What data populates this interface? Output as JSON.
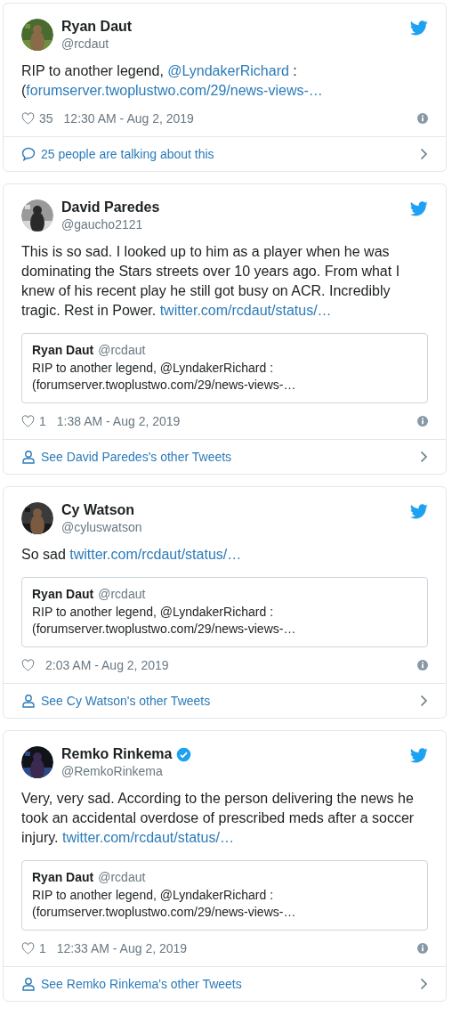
{
  "tweets": [
    {
      "name": "Ryan Daut",
      "verified": false,
      "handle": "@rcdaut",
      "body": [
        {
          "kind": "plain",
          "text": "RIP to another legend, "
        },
        {
          "kind": "link",
          "text": "@LyndakerRichard"
        },
        {
          "kind": "plain",
          "text": " : ("
        },
        {
          "kind": "link",
          "text": "forumserver.twoplustwo.com/29/news-views-…"
        }
      ],
      "likes": "35",
      "time": "12:30 AM - Aug 2, 2019",
      "footer": {
        "kind": "conversation",
        "text": "25 people are talking about this"
      }
    },
    {
      "name": "David Paredes",
      "verified": false,
      "handle": "@gaucho2121",
      "body": [
        {
          "kind": "plain",
          "text": "This is so sad. I looked up to him as a player when he was dominating the Stars streets over 10 years ago. From what I knew of his recent play he still got busy on ACR. Incredibly tragic. Rest in Power. "
        },
        {
          "kind": "link",
          "text": "twitter.com/rcdaut/status/…"
        }
      ],
      "quote": {
        "name": "Ryan Daut",
        "handle": "@rcdaut",
        "text": "RIP to another legend, @LyndakerRichard : (forumserver.twoplustwo.com/29/news-views-…"
      },
      "likes": "1",
      "time": "1:38 AM - Aug 2, 2019",
      "footer": {
        "kind": "profile",
        "text": "See David Paredes's other Tweets"
      }
    },
    {
      "name": "Cy Watson",
      "verified": false,
      "handle": "@cyluswatson",
      "body": [
        {
          "kind": "plain",
          "text": "So sad "
        },
        {
          "kind": "link",
          "text": "twitter.com/rcdaut/status/…"
        }
      ],
      "quote": {
        "name": "Ryan Daut",
        "handle": "@rcdaut",
        "text": "RIP to another legend, @LyndakerRichard : (forumserver.twoplustwo.com/29/news-views-…"
      },
      "time": "2:03 AM - Aug 2, 2019",
      "footer": {
        "kind": "profile",
        "text": "See Cy Watson's other Tweets"
      }
    },
    {
      "name": "Remko Rinkema",
      "verified": true,
      "handle": "@RemkoRinkema",
      "body": [
        {
          "kind": "plain",
          "text": "Very, very sad. According to the person delivering the news he took an accidental overdose of prescribed meds after a soccer injury. "
        },
        {
          "kind": "link",
          "text": "twitter.com/rcdaut/status/…"
        }
      ],
      "quote": {
        "name": "Ryan Daut",
        "handle": "@rcdaut",
        "text": "RIP to another legend, @LyndakerRichard : (forumserver.twoplustwo.com/29/news-views-…"
      },
      "likes": "1",
      "time": "12:33 AM - Aug 2, 2019",
      "footer": {
        "kind": "profile",
        "text": "See Remko Rinkema's other Tweets"
      }
    }
  ]
}
